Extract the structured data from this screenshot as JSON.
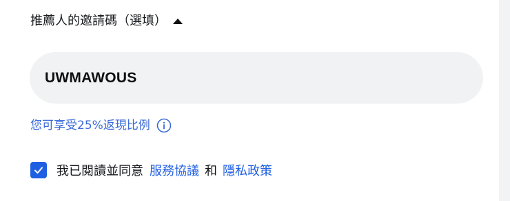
{
  "referral": {
    "title": "推薦人的邀請碼（選填）",
    "toggle_icon": "caret-up-icon",
    "code_value": "UWMAWOUS",
    "rebate_text": "您可享受25%返現比例",
    "info_icon": "info-circle-icon"
  },
  "agreement": {
    "checked": true,
    "prefix": "我已閱讀並同意",
    "service_link": "服務協議",
    "conjunction": "和",
    "privacy_link": "隱私政策"
  },
  "colors": {
    "accent": "#1f5fe2",
    "rebate_text": "#3a6ad8",
    "input_bg": "#f1f2f4",
    "page_bg": "#f2f3f5"
  }
}
